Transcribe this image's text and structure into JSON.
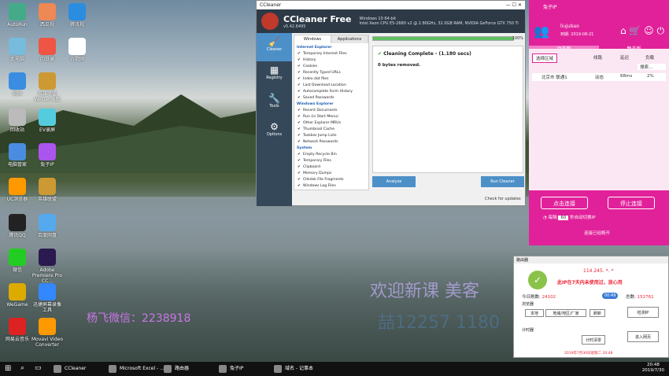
{
  "desktop": {
    "icons": [
      {
        "label": "AutoRun"
      },
      {
        "label": "西瓜视"
      },
      {
        "label": "腾讯视"
      },
      {
        "label": "此电脑"
      },
      {
        "label": "闪日录"
      },
      {
        "label": "谷歌网"
      },
      {
        "label": "网络"
      },
      {
        "label": "英雄联盟WeGame版"
      },
      {
        "label": "回收站"
      },
      {
        "label": "EV录屏"
      },
      {
        "label": "电脑管家"
      },
      {
        "label": "兔子IP"
      },
      {
        "label": "UC浏览器"
      },
      {
        "label": "英雄联盟"
      },
      {
        "label": "腾讯QQ"
      },
      {
        "label": "百度网盘"
      },
      {
        "label": "微信"
      },
      {
        "label": "Adobe Premiere Pro CC..."
      },
      {
        "label": "WeGame"
      },
      {
        "label": "迅捷屏幕录像工具"
      },
      {
        "label": "网易云音乐"
      },
      {
        "label": "Movavi Video Converter"
      }
    ],
    "watermark_wechat": "杨飞微信：2238918",
    "watermark_line2": "欢迎新课 美客",
    "watermark_line3": "喆12257 1180"
  },
  "ccleaner": {
    "titlebar": "CCleaner",
    "name": "CCleaner Free",
    "version": "v5.42.6495",
    "sys_line1": "Windows 10 64-bit",
    "sys_line2": "Intel Xeon CPU E5-2680 v2 @ 2.80GHz, 32.0GB RAM, NVIDIA GeForce GTX 750 Ti",
    "side": [
      {
        "label": "Cleaner"
      },
      {
        "label": "Registry"
      },
      {
        "label": "Tools"
      },
      {
        "label": "Options"
      }
    ],
    "tabs": [
      "Windows",
      "Applications"
    ],
    "list": [
      {
        "t": "g",
        "label": "Internet Explorer"
      },
      {
        "t": "i",
        "label": "Temporary Internet Files"
      },
      {
        "t": "i",
        "label": "History"
      },
      {
        "t": "i",
        "label": "Cookies"
      },
      {
        "t": "i",
        "label": "Recently Typed URLs"
      },
      {
        "t": "i",
        "label": "Index.dat files"
      },
      {
        "t": "i",
        "label": "Last Download Location"
      },
      {
        "t": "i",
        "label": "Autocomplete Form History"
      },
      {
        "t": "i",
        "label": "Saved Passwords"
      },
      {
        "t": "g",
        "label": "Windows Explorer"
      },
      {
        "t": "i",
        "label": "Recent Documents"
      },
      {
        "t": "i",
        "label": "Run (in Start Menu)"
      },
      {
        "t": "i",
        "label": "Other Explorer MRUs"
      },
      {
        "t": "i",
        "label": "Thumbnail Cache"
      },
      {
        "t": "i",
        "label": "Taskbar Jump Lists"
      },
      {
        "t": "i",
        "label": "Network Passwords"
      },
      {
        "t": "g",
        "label": "System"
      },
      {
        "t": "i",
        "label": "Empty Recycle Bin"
      },
      {
        "t": "i",
        "label": "Temporary Files"
      },
      {
        "t": "i",
        "label": "Clipboard"
      },
      {
        "t": "i",
        "label": "Memory Dumps"
      },
      {
        "t": "i",
        "label": "Chkdsk File Fragments"
      },
      {
        "t": "i",
        "label": "Windows Log Files"
      }
    ],
    "progress": 1.0,
    "progress_label": "100%",
    "result_title": "Cleaning Complete - (1.180 secs)",
    "result_body": "0 bytes removed.",
    "analyze_label": "Analyze",
    "run_label": "Run Cleaner",
    "check_updates": "Check for updates"
  },
  "tuzi": {
    "app": "兔子IP",
    "user": "liujubao",
    "expiry": "到期: 2019-08-21",
    "tabs": [
      "动态版",
      "静态版"
    ],
    "region_select": "选择区域",
    "cols": [
      "线路",
      "延迟",
      "负载"
    ],
    "search_placeholder": "搜索...",
    "row": {
      "name": "北京市 联通1",
      "type": "动态",
      "latency": "68ms",
      "load": "2%"
    },
    "connect": "点击连接",
    "disconnect": "停止连接",
    "interval_label": "每隔",
    "interval_value": "60",
    "interval_suffix": "秒自动切换IP",
    "status": "连接已经断开"
  },
  "router": {
    "title": "路由器",
    "ip": "114.245. *. *",
    "notice": "此IP在7天内未使用过，放心用",
    "today_label": "今日刷数:",
    "today_value": "24102",
    "total_label": "总数:",
    "total_value": "152761",
    "browser_label": "浏览器",
    "local_label": "本地",
    "region_btn": "地域/地区/厂家",
    "refresh_btn": "刷新",
    "check_btn": "检测IP",
    "counter_label": "计时器",
    "timer_btn": "计时清零",
    "enter_btn": "进入网页",
    "footer": "2019年7月30日星期二 20:48",
    "badge": "00:49"
  },
  "taskbar": {
    "items": [
      "CCleaner",
      "Microsoft Excel - ...",
      "路由器",
      "兔子IP",
      "域名 - 记事本"
    ],
    "time": "20:48",
    "date": "2019/7/30"
  }
}
